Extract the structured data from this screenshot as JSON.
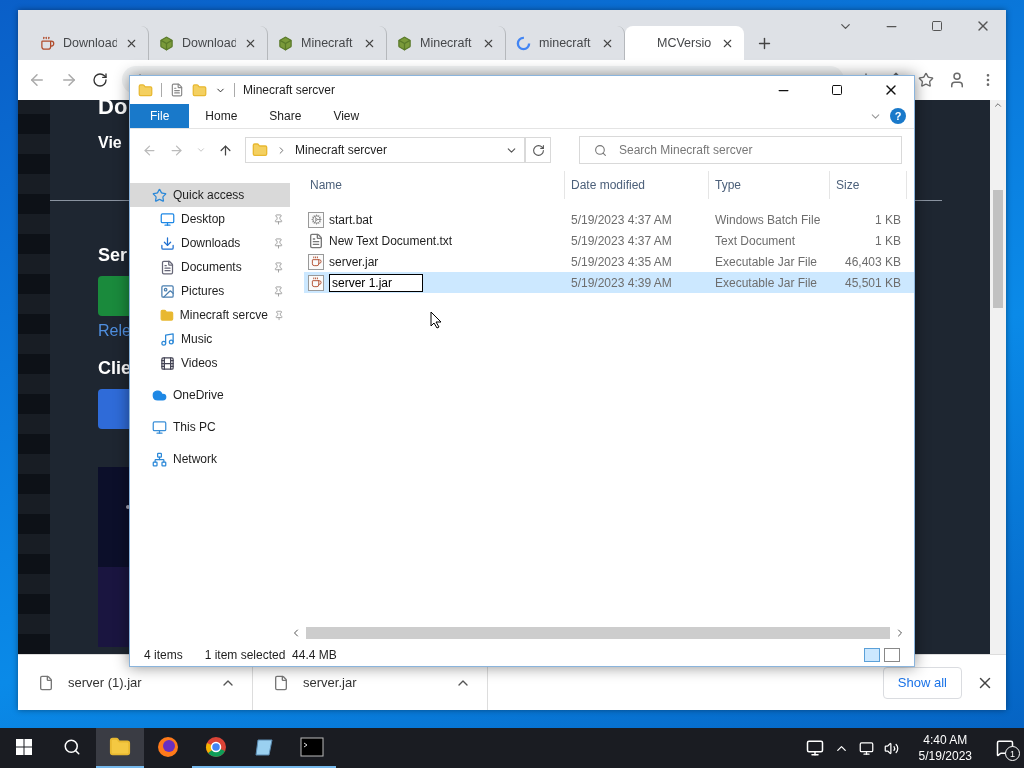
{
  "browser": {
    "tabs": [
      {
        "title": "Download",
        "selected": false
      },
      {
        "title": "Download",
        "selected": false
      },
      {
        "title": "Minecraft",
        "selected": false
      },
      {
        "title": "Minecraft",
        "selected": false
      },
      {
        "title": "minecraft",
        "selected": false
      },
      {
        "title": "MCVersio",
        "selected": true
      }
    ],
    "page": {
      "heading": "Do",
      "subheading": "Vie",
      "server_heading": "Ser",
      "release_link": "Rele",
      "client_heading": "Clie"
    },
    "downloads": [
      {
        "name": "server (1).jar"
      },
      {
        "name": "server.jar"
      }
    ],
    "show_all": "Show all"
  },
  "explorer": {
    "title": "Minecraft sercver",
    "ribbon_tabs": [
      {
        "label": "File",
        "kind": "file",
        "selected": false
      },
      {
        "label": "Home",
        "kind": "tab",
        "selected": false
      },
      {
        "label": "Share",
        "kind": "tab",
        "selected": false
      },
      {
        "label": "View",
        "kind": "tab",
        "selected": false
      }
    ],
    "help": "?",
    "path": "Minecraft sercver",
    "search": {
      "placeholder": "Search Minecraft sercver"
    },
    "nav": [
      {
        "label": "Quick access",
        "selected": true,
        "children": [
          {
            "label": "Desktop",
            "pinned": true,
            "selected": false
          },
          {
            "label": "Downloads",
            "pinned": true,
            "selected": false
          },
          {
            "label": "Documents",
            "pinned": true,
            "selected": false
          },
          {
            "label": "Pictures",
            "pinned": true,
            "selected": false
          },
          {
            "label": "Minecraft sercve",
            "pinned": true,
            "selected": false
          },
          {
            "label": "Music",
            "pinned": false,
            "selected": false
          },
          {
            "label": "Videos",
            "pinned": false,
            "selected": false
          }
        ]
      },
      {
        "label": "OneDrive",
        "selected": false
      },
      {
        "label": "This PC",
        "selected": false
      },
      {
        "label": "Network",
        "selected": false
      }
    ],
    "columns": [
      "Name",
      "Date modified",
      "Type",
      "Size"
    ],
    "rows": [
      {
        "name": "start.bat",
        "date": "5/19/2023 4:37 AM",
        "type": "Windows Batch File",
        "size": "1 KB",
        "selected": false,
        "renaming": false
      },
      {
        "name": "New Text Document.txt",
        "date": "5/19/2023 4:37 AM",
        "type": "Text Document",
        "size": "1 KB",
        "selected": false,
        "renaming": false
      },
      {
        "name": "server.jar",
        "date": "5/19/2023 4:35 AM",
        "type": "Executable Jar File",
        "size": "46,403 KB",
        "selected": false,
        "renaming": false
      },
      {
        "name": "server 1.jar",
        "date": "5/19/2023 4:39 AM",
        "type": "Executable Jar File",
        "size": "45,501 KB",
        "selected": true,
        "renaming": true
      }
    ],
    "status": {
      "count": "4 items",
      "selection": "1 item selected",
      "selection_size": "44.4 MB"
    }
  },
  "taskbar": {
    "apps": [
      {
        "active": true,
        "running": true
      },
      {
        "active": false,
        "running": false
      },
      {
        "active": false,
        "running": true
      },
      {
        "active": false,
        "running": true
      },
      {
        "active": false,
        "running": true
      }
    ],
    "time": "4:40 AM",
    "date": "5/19/2023",
    "notifications": "1"
  }
}
